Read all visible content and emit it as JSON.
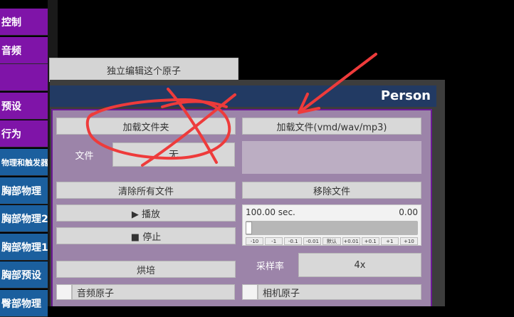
{
  "sidebar": {
    "items": [
      {
        "label": "控制",
        "variant": "purple"
      },
      {
        "label": "音频",
        "variant": "purple"
      },
      {
        "label": "",
        "variant": "purple"
      },
      {
        "label": "预设",
        "variant": "purple"
      },
      {
        "label": "行为",
        "variant": "purple"
      },
      {
        "label": "物理和触发器",
        "variant": "blue"
      },
      {
        "label": "胸部物理",
        "variant": "blue"
      },
      {
        "label": "胸部物理2",
        "variant": "blue"
      },
      {
        "label": "胸部物理1",
        "variant": "blue"
      },
      {
        "label": "胸部预设",
        "variant": "blue"
      },
      {
        "label": "臀部物理",
        "variant": "blue"
      }
    ]
  },
  "top_button": {
    "label": "独立编辑这个原子"
  },
  "panel": {
    "title": "Person",
    "load_folder_label": "加载文件夹",
    "load_file_label": "加载文件(vmd/wav/mp3)",
    "file_label": "文件",
    "file_value": "无",
    "clear_all_label": "清除所有文件",
    "remove_file_label": "移除文件",
    "play_label": "▶ 播放",
    "stop_label": "■ 停止",
    "time_value": "100.00 sec.",
    "time_readout": "0.00",
    "slider_position": 0,
    "step_buttons": [
      "-10",
      "-1",
      "-0.1",
      "-0.01",
      "默认",
      "+0.01",
      "+0.1",
      "+1",
      "+10"
    ],
    "bake_label": "烘培",
    "sample_rate_label": "采样率",
    "sample_rate_value": "4x",
    "audio_atom_label": "音频原子",
    "camera_atom_label": "相机原子"
  },
  "colors": {
    "sidebar_purple": "#7f14a8",
    "sidebar_blue": "#1b5f9e",
    "panel_header": "#223a63",
    "panel_body": "#9c84a9",
    "annotation_red": "#ee3b3b"
  },
  "annotations": {
    "scribble": "red-circle-cross",
    "arrow": "red-arrow"
  }
}
